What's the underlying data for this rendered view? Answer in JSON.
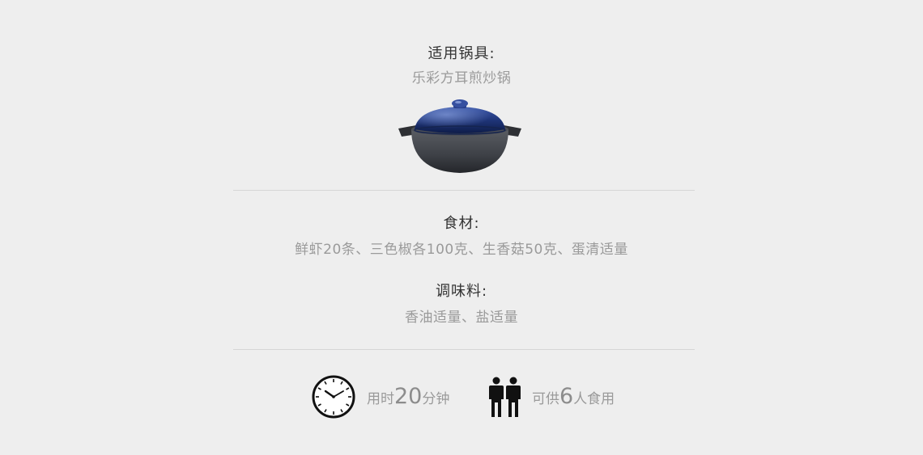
{
  "cookware": {
    "label": "适用锅具:",
    "value": "乐彩方耳煎炒锅",
    "image_icon": "pot-icon"
  },
  "ingredients": {
    "label": "食材:",
    "value": "鲜虾20条、三色椒各100克、生香菇50克、蛋清适量"
  },
  "seasoning": {
    "label": "调味料:",
    "value": "香油适量、盐适量"
  },
  "time": {
    "icon": "clock-icon",
    "prefix": "用时",
    "number": "20",
    "suffix": "分钟"
  },
  "servings": {
    "icon": "people-icon",
    "prefix": "可供",
    "number": "6",
    "suffix": "人食用"
  },
  "colors": {
    "background": "#eeeeee",
    "label": "#333333",
    "value": "#9a9a9a",
    "divider": "#d6d6d6",
    "lid_blue": "#1f3579"
  }
}
